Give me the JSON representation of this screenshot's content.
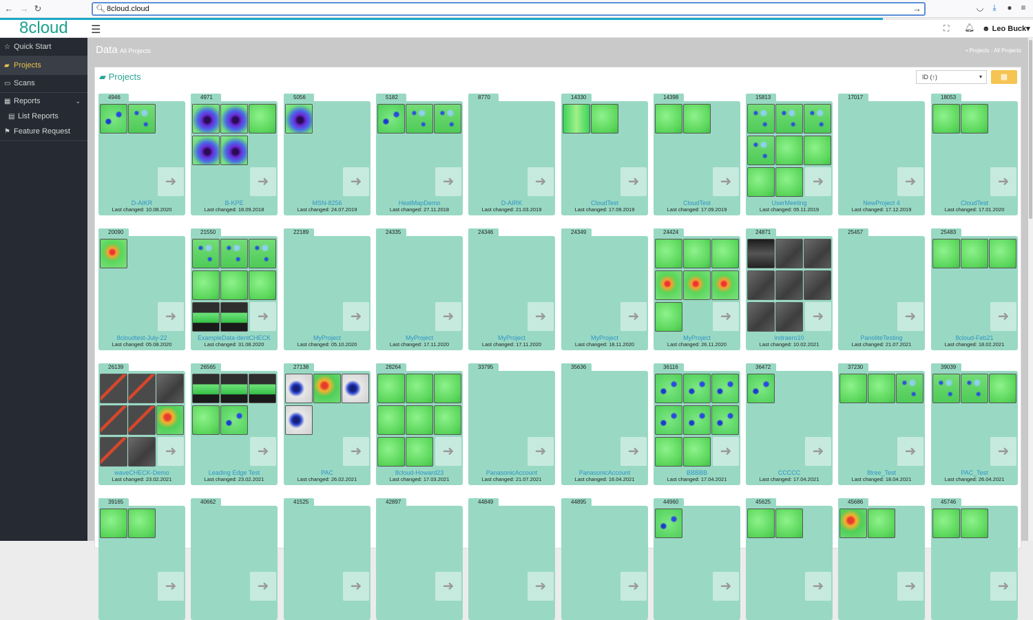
{
  "browser": {
    "url": "8cloud.cloud",
    "back_icon": "arrow-left-icon",
    "forward_icon": "arrow-right-icon",
    "reload_icon": "reload-icon"
  },
  "app": {
    "logo_number": "8",
    "logo_text": "cloud",
    "user_name": "Leo Buck",
    "accent_color": "#1aa08c",
    "folder_color": "#99d9c3",
    "active_nav_color": "#e8c24a"
  },
  "sidebar": {
    "items": [
      {
        "label": "Quick Start",
        "icon": "star-icon"
      },
      {
        "label": "Projects",
        "icon": "folder-open-icon"
      },
      {
        "label": "Scans",
        "icon": "scan-icon"
      },
      {
        "label": "Reports",
        "icon": "table-icon"
      },
      {
        "label": "List Reports",
        "icon": "list-icon"
      },
      {
        "label": "Feature Request",
        "icon": "flag-icon"
      }
    ]
  },
  "header": {
    "title": "Data",
    "subtitle": "All Projects",
    "breadcrumb_1": "Projects",
    "breadcrumb_sep": "›",
    "breadcrumb_2": "All Projects"
  },
  "panel": {
    "title": "Projects",
    "sort_value": "ID (↑)"
  },
  "projects": [
    {
      "id": "4946",
      "name": "D-AIKR",
      "date": "Last changed: 10.08.2020",
      "thumbs": [
        "t-green-spots",
        "t-bluegreen"
      ]
    },
    {
      "id": "4971",
      "name": "B-KPE",
      "date": "Last changed: 18.09.2018",
      "thumbs": [
        "t-blueblob",
        "t-blueblob",
        "t-green",
        "t-blueblob",
        "t-blueblob"
      ]
    },
    {
      "id": "5056",
      "name": "MSN-8256",
      "date": "Last changed: 24.07.2019",
      "thumbs": [
        "t-blueblob"
      ]
    },
    {
      "id": "5182",
      "name": "HeatMapDemo",
      "date": "Last changed: 27.11.2018",
      "thumbs": [
        "t-green-spots",
        "t-bluegreen",
        "t-bluegreen"
      ]
    },
    {
      "id": "8770",
      "name": "D-AIRK",
      "date": "Last changed: 21.03.2019",
      "thumbs": []
    },
    {
      "id": "14330",
      "name": "CloudTest",
      "date": "Last changed: 17.09.2019",
      "thumbs": [
        "t-mixed",
        "t-green"
      ]
    },
    {
      "id": "14398",
      "name": "CloudTest",
      "date": "Last changed: 17.09.2019",
      "thumbs": [
        "t-green",
        "t-green"
      ]
    },
    {
      "id": "15813",
      "name": "UserMeeting",
      "date": "Last changed: 05.11.2019",
      "thumbs": [
        "t-bluegreen",
        "t-bluegreen",
        "t-bluegreen",
        "t-bluegreen",
        "t-green",
        "t-green",
        "t-green",
        "t-green"
      ]
    },
    {
      "id": "17017",
      "name": "NewProject 4",
      "date": "Last changed: 17.12.2019",
      "thumbs": []
    },
    {
      "id": "18053",
      "name": "CloudTest",
      "date": "Last changed: 17.01.2020",
      "thumbs": [
        "t-green",
        "t-green"
      ]
    },
    {
      "id": "20090",
      "name": "8cloudtest-July-22",
      "date": "Last changed: 05.08.2020",
      "thumbs": [
        "t-heat"
      ]
    },
    {
      "id": "21550",
      "name": "ExampleData-dentCHECK",
      "date": "Last changed: 31.08.2020",
      "thumbs": [
        "t-bluegreen",
        "t-bluegreen",
        "t-bluegreen",
        "t-green",
        "t-green",
        "t-green",
        "t-darkband",
        "t-darkband"
      ]
    },
    {
      "id": "22189",
      "name": "MyProject",
      "date": "Last changed: 05.10.2020",
      "thumbs": []
    },
    {
      "id": "24335",
      "name": "MyProject",
      "date": "Last changed: 17.11.2020",
      "thumbs": []
    },
    {
      "id": "24346",
      "name": "MyProject",
      "date": "Last changed: 17.11.2020",
      "thumbs": []
    },
    {
      "id": "24349",
      "name": "MyProject",
      "date": "Last changed: 18.11.2020",
      "thumbs": []
    },
    {
      "id": "24424",
      "name": "MyProject",
      "date": "Last changed: 26.11.2020",
      "thumbs": [
        "t-green",
        "t-green",
        "t-green",
        "t-heat",
        "t-heat",
        "t-heat",
        "t-green"
      ]
    },
    {
      "id": "24871",
      "name": "indraero10",
      "date": "Last changed: 10.02.2021",
      "thumbs": [
        "t-dark",
        "t-gray",
        "t-gray",
        "t-gray",
        "t-gray",
        "t-gray",
        "t-gray",
        "t-gray"
      ]
    },
    {
      "id": "25457",
      "name": "PanoliteTesting",
      "date": "Last changed: 21.07.2021",
      "thumbs": []
    },
    {
      "id": "25483",
      "name": "8cloud-Feb21",
      "date": "Last changed: 18.02.2021",
      "thumbs": [
        "t-green",
        "t-green",
        "t-green"
      ]
    },
    {
      "id": "26139",
      "name": "waveCHECK-Demo",
      "date": "Last changed: 23.02.2021",
      "thumbs": [
        "t-grayred",
        "t-grayred",
        "t-gray",
        "t-grayred",
        "t-grayred",
        "t-redheat",
        "t-grayred",
        "t-gray"
      ]
    },
    {
      "id": "26565",
      "name": "Leading Edge Test",
      "date": "Last changed: 23.02.2021",
      "thumbs": [
        "t-darkband",
        "t-darkband",
        "t-darkband",
        "t-green",
        "t-green-spots"
      ]
    },
    {
      "id": "27138",
      "name": "PAC",
      "date": "Last changed: 26.02.2021",
      "thumbs": [
        "t-whiteblob",
        "t-redheat",
        "t-whiteblob",
        "t-whiteblob"
      ]
    },
    {
      "id": "28264",
      "name": "8cloud-Howard23",
      "date": "Last changed: 17.03.2021",
      "thumbs": [
        "t-green",
        "t-green",
        "t-green",
        "t-green",
        "t-green",
        "t-green",
        "t-green",
        "t-green"
      ]
    },
    {
      "id": "33795",
      "name": "PanasonicAccount",
      "date": "Last changed: 21.07.2021",
      "thumbs": []
    },
    {
      "id": "35636",
      "name": "PanasonicAccount",
      "date": "Last changed: 16.04.2021",
      "thumbs": []
    },
    {
      "id": "36116",
      "name": "BBBBB",
      "date": "Last changed: 17.04.2021",
      "thumbs": [
        "t-green-spots",
        "t-green-spots",
        "t-green-spots",
        "t-green-spots",
        "t-green-spots",
        "t-green-spots",
        "t-green",
        "t-green"
      ]
    },
    {
      "id": "36472",
      "name": "CCCCC",
      "date": "Last changed: 17.04.2021",
      "thumbs": [
        "t-green-spots"
      ]
    },
    {
      "id": "37230",
      "name": "8tree_Test",
      "date": "Last changed: 18.04.2021",
      "thumbs": [
        "t-green",
        "t-green",
        "t-bluegreen"
      ]
    },
    {
      "id": "39039",
      "name": "PAC_Test",
      "date": "Last changed: 26.04.2021",
      "thumbs": [
        "t-bluegreen",
        "t-bluegreen",
        "t-green"
      ]
    },
    {
      "id": "39165",
      "name": "",
      "date": "",
      "thumbs": [
        "t-green",
        "t-green"
      ]
    },
    {
      "id": "40662",
      "name": "",
      "date": "",
      "thumbs": []
    },
    {
      "id": "41525",
      "name": "",
      "date": "",
      "thumbs": []
    },
    {
      "id": "42897",
      "name": "",
      "date": "",
      "thumbs": []
    },
    {
      "id": "44849",
      "name": "",
      "date": "",
      "thumbs": []
    },
    {
      "id": "44895",
      "name": "",
      "date": "",
      "thumbs": []
    },
    {
      "id": "44960",
      "name": "",
      "date": "",
      "thumbs": [
        "t-green-spots"
      ]
    },
    {
      "id": "45625",
      "name": "",
      "date": "",
      "thumbs": [
        "t-green",
        "t-green"
      ]
    },
    {
      "id": "45686",
      "name": "",
      "date": "",
      "thumbs": [
        "t-redheat",
        "t-green"
      ]
    },
    {
      "id": "45746",
      "name": "",
      "date": "",
      "thumbs": [
        "t-green",
        "t-green"
      ]
    }
  ]
}
